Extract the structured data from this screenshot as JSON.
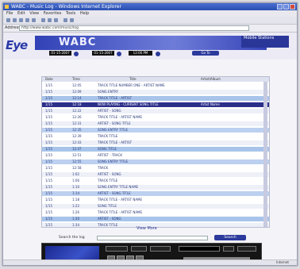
{
  "window": {
    "title": "WABC - Music Log - Windows Internet Explorer"
  },
  "menu": [
    "File",
    "Edit",
    "View",
    "Favorites",
    "Tools",
    "Help"
  ],
  "address": {
    "label": "Address",
    "url": "http://www.wabc.com/music/log"
  },
  "site": {
    "logo": "Eye",
    "station": "WABC",
    "user_label": "Mobile Stations"
  },
  "controls": {
    "date_from": "01-15-2007",
    "date_to": "01-15-2007",
    "time": "12:00 PM",
    "go_label": "Go To"
  },
  "table": {
    "headers": [
      "Date",
      "Time",
      "Title",
      "Artist/Album"
    ],
    "rows": [
      {
        "date": "1/15",
        "time": "12:05",
        "title": "TRACK TITLE NUMBER ONE - ARTIST NAME",
        "artist": ""
      },
      {
        "date": "1/15",
        "time": "12:09",
        "title": "SONG ENTRY",
        "artist": ""
      },
      {
        "date": "1/15",
        "time": "12:14",
        "title": "TRACK TITLE - ARTIST",
        "artist": ""
      },
      {
        "date": "1/15",
        "time": "12:18",
        "title": "NOW PLAYING - CURRENT SONG TITLE",
        "artist": "Artist Name"
      },
      {
        "date": "1/15",
        "time": "12:22",
        "title": "ARTIST - SONG",
        "artist": ""
      },
      {
        "date": "1/15",
        "time": "12:26",
        "title": "TRACK TITLE - ARTIST NAME",
        "artist": ""
      },
      {
        "date": "1/15",
        "time": "12:31",
        "title": "ARTIST - SONG TITLE",
        "artist": ""
      },
      {
        "date": "1/15",
        "time": "12:35",
        "title": "SONG ENTRY TITLE",
        "artist": ""
      },
      {
        "date": "1/15",
        "time": "12:39",
        "title": "TRACK TITLE",
        "artist": ""
      },
      {
        "date": "1/15",
        "time": "12:43",
        "title": "TRACK TITLE - ARTIST",
        "artist": ""
      },
      {
        "date": "1/15",
        "time": "12:47",
        "title": "SONG TITLE",
        "artist": ""
      },
      {
        "date": "1/15",
        "time": "12:51",
        "title": "ARTIST - TRACK",
        "artist": ""
      },
      {
        "date": "1/15",
        "time": "12:55",
        "title": "SONG ENTRY TITLE",
        "artist": ""
      },
      {
        "date": "1/15",
        "time": "12:58",
        "title": "TRACK",
        "artist": ""
      },
      {
        "date": "1/15",
        "time": "1:02",
        "title": "ARTIST - SONG",
        "artist": ""
      },
      {
        "date": "1/15",
        "time": "1:06",
        "title": "TRACK TITLE",
        "artist": ""
      },
      {
        "date": "1/15",
        "time": "1:10",
        "title": "SONG ENTRY TITLE NAME",
        "artist": ""
      },
      {
        "date": "1/15",
        "time": "1:14",
        "title": "ARTIST - SONG TITLE",
        "artist": ""
      },
      {
        "date": "1/15",
        "time": "1:18",
        "title": "TRACK TITLE - ARTIST NAME",
        "artist": ""
      },
      {
        "date": "1/15",
        "time": "1:22",
        "title": "SONG TITLE",
        "artist": ""
      },
      {
        "date": "1/15",
        "time": "1:26",
        "title": "TRACK TITLE - ARTIST NAME",
        "artist": ""
      },
      {
        "date": "1/15",
        "time": "1:30",
        "title": "ARTIST - SONG",
        "artist": ""
      },
      {
        "date": "1/15",
        "time": "1:34",
        "title": "TRACK TITLE",
        "artist": ""
      }
    ]
  },
  "view_more": "View More",
  "search": {
    "label": "Search the log",
    "button": "Search"
  },
  "status": "Internet"
}
